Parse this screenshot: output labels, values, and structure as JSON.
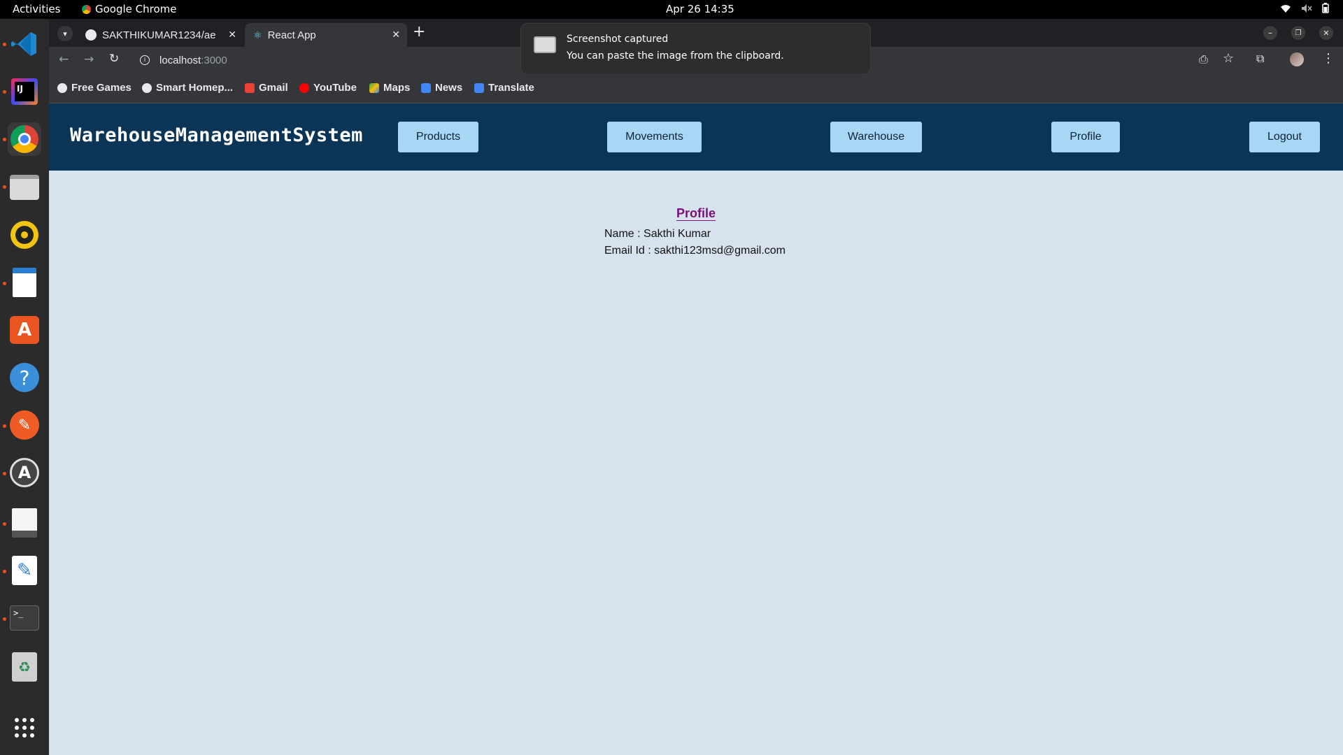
{
  "topbar": {
    "activities": "Activities",
    "app_name": "Google Chrome",
    "clock": "Apr 26  14:35"
  },
  "chrome": {
    "tabs": [
      {
        "title": "SAKTHIKUMAR1234/ae",
        "icon": "github-icon"
      },
      {
        "title": "React App",
        "icon": "react-icon"
      }
    ],
    "address": "localhost",
    "address_port": ":3000",
    "bookmarks": [
      {
        "label": "Free Games",
        "icon": "globe-icon"
      },
      {
        "label": "Smart Homep...",
        "icon": "globe-icon"
      },
      {
        "label": "Gmail",
        "icon": "gmail-icon"
      },
      {
        "label": "YouTube",
        "icon": "youtube-icon"
      },
      {
        "label": "Maps",
        "icon": "maps-icon"
      },
      {
        "label": "News",
        "icon": "news-icon"
      },
      {
        "label": "Translate",
        "icon": "translate-icon"
      }
    ]
  },
  "notification": {
    "title": "Screenshot captured",
    "body": "You can paste the image from the clipboard."
  },
  "app": {
    "brand": "WarehouseManagementSystem",
    "nav": {
      "products": "Products",
      "movements": "Movements",
      "warehouse": "Warehouse",
      "profile": "Profile",
      "logout": "Logout"
    },
    "profile": {
      "title": "Profile",
      "name_label": "Name :",
      "name_value": "Sakthi Kumar",
      "email_label": "Email Id :",
      "email_value": "sakthi123msd@gmail.com"
    }
  },
  "colors": {
    "nav_bg": "#0b3556",
    "nav_button": "#a8d7f5",
    "page_bg": "#d6e3ee",
    "profile_title": "#7a0f7a"
  }
}
